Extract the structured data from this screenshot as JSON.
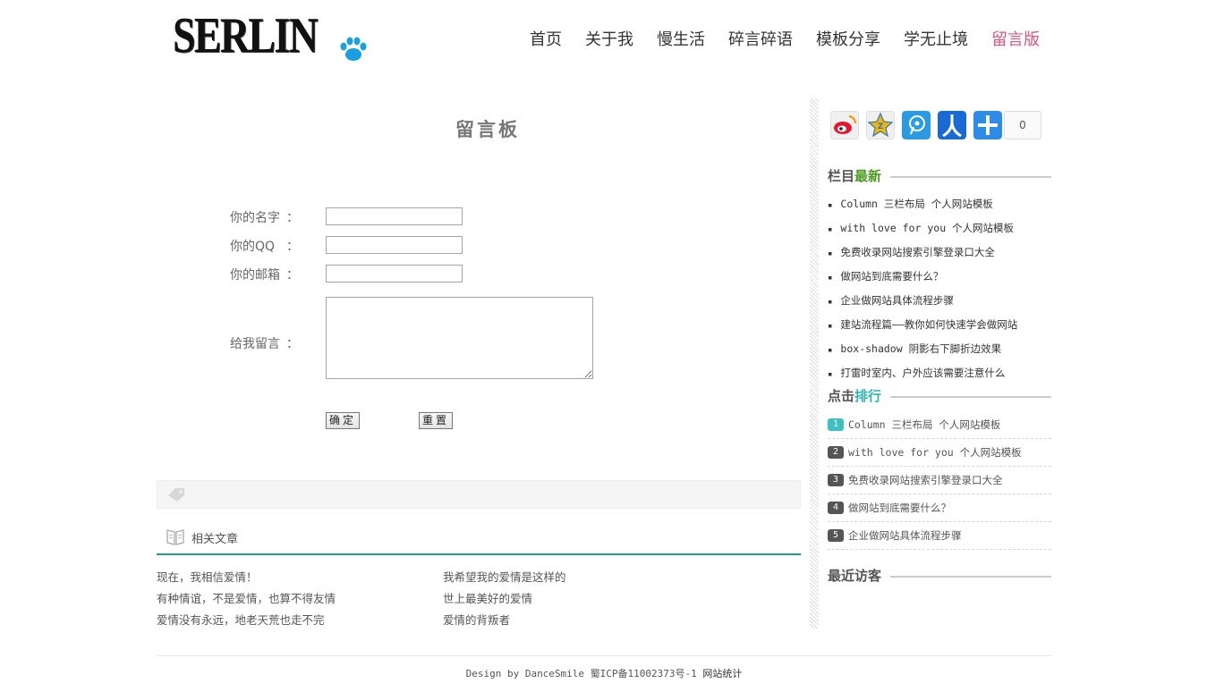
{
  "header": {
    "logo_text": "SERLIN",
    "nav": [
      "首页",
      "关于我",
      "慢生活",
      "碎言碎语",
      "模板分享",
      "学无止境",
      "留言版"
    ]
  },
  "main": {
    "title": "留言板",
    "form": {
      "name_label": "你的名字",
      "qq_label": "你的QQ",
      "email_label": "你的邮箱",
      "message_label": "给我留言",
      "colon": "：",
      "submit_label": "确定",
      "reset_label": "重置"
    },
    "related": {
      "title": "相关文章",
      "left": [
        "现在，我相信爱情！",
        "有种情谊，不是爱情，也算不得友情",
        "爱情没有永远，地老天荒也走不完"
      ],
      "right": [
        "我希望我的爱情是这样的",
        "世上最美好的爱情",
        "爱情的背叛者"
      ]
    }
  },
  "sidebar": {
    "share_count": "0",
    "latest_head_1": "栏目",
    "latest_head_2": "最新",
    "latest": [
      "Column 三栏布局 个人网站模板",
      "with love for you 个人网站模板",
      "免费收录网站搜索引擎登录口大全",
      "做网站到底需要什么？",
      "企业做网站具体流程步骤",
      "建站流程篇——教你如何快速学会做网站",
      "box-shadow 阴影右下脚折边效果",
      "打雷时室内、户外应该需要注意什么"
    ],
    "rank_head_1": "点击",
    "rank_head_2": "排行",
    "rank": [
      {
        "num": "1",
        "title": "Column 三栏布局 个人网站模板"
      },
      {
        "num": "2",
        "title": "with love for you 个人网站模板"
      },
      {
        "num": "3",
        "title": "免费收录网站搜索引擎登录口大全"
      },
      {
        "num": "4",
        "title": "做网站到底需要什么？"
      },
      {
        "num": "5",
        "title": "企业做网站具体流程步骤"
      }
    ],
    "visitors_head": "最近访客"
  },
  "footer": {
    "text": "Design by DanceSmile 蜀ICP备11002373号-1",
    "stat_link": "网站统计"
  },
  "colors": {
    "nav_active": "#d9577f",
    "accent_green": "#4a9b1f",
    "accent_teal": "#2eb6b0",
    "related_rule": "#1f9b93"
  }
}
